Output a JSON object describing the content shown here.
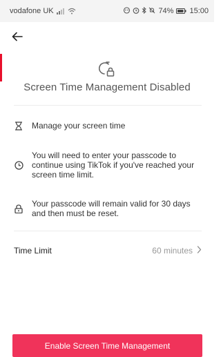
{
  "status_bar": {
    "carrier": "vodafone UK",
    "battery_percent": "74%",
    "time": "15:00",
    "icons": [
      "signal-icon",
      "wifi-icon",
      "notification-icon",
      "alarm-icon",
      "bluetooth-icon",
      "mute-icon",
      "battery-icon"
    ]
  },
  "header": {
    "back_icon": "arrow-left-icon"
  },
  "hero": {
    "icon": "timer-lock-icon",
    "title": "Screen Time Management Disabled"
  },
  "info_items": [
    {
      "icon": "hourglass-icon",
      "text": "Manage your screen time"
    },
    {
      "icon": "clock-icon",
      "text": "You will need to enter your passcode to continue using TikTok if you've reached your screen time limit."
    },
    {
      "icon": "lock-icon",
      "text": "Your passcode will remain valid for 30 days and then must be reset."
    }
  ],
  "time_limit": {
    "label": "Time Limit",
    "value": "60 minutes",
    "chevron_icon": "chevron-right-icon"
  },
  "enable_button": {
    "label": "Enable Screen Time Management"
  },
  "colors": {
    "accent": "#f0335a",
    "status_bar_bg": "#f4f4f4",
    "marker": "#e8102c"
  }
}
